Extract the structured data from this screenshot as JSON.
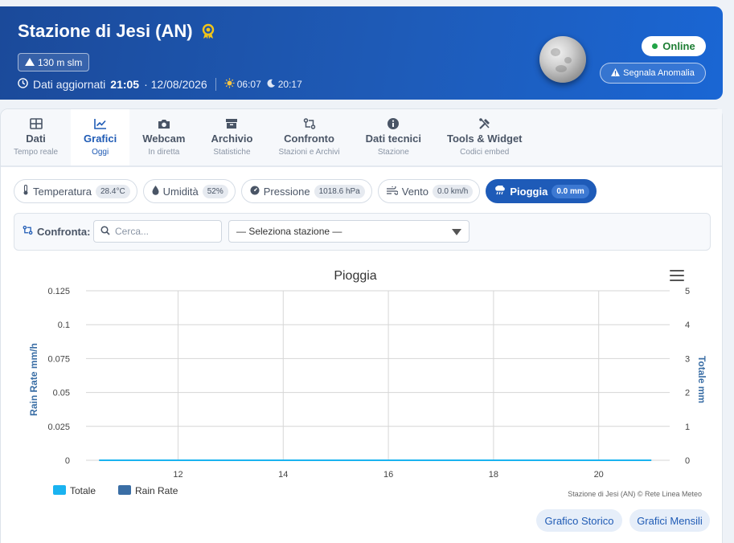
{
  "header": {
    "title": "Stazione di Jesi (AN)",
    "altitude": "130 m slm",
    "updated_label": "Dati aggiornati",
    "updated_time": "21:05",
    "updated_date": "· 12/08/2026",
    "sunrise": "06:07",
    "sunset": "20:17",
    "status": "Online",
    "report_label": "Segnala Anomalia"
  },
  "tabs": [
    {
      "label": "Dati",
      "sub": "Tempo reale",
      "icon": "table-icon"
    },
    {
      "label": "Grafici",
      "sub": "Oggi",
      "icon": "chart-icon",
      "active": true
    },
    {
      "label": "Webcam",
      "sub": "In diretta",
      "icon": "camera-icon"
    },
    {
      "label": "Archivio",
      "sub": "Statistiche",
      "icon": "archive-icon"
    },
    {
      "label": "Confronto",
      "sub": "Stazioni e Archivi",
      "icon": "compare-icon"
    },
    {
      "label": "Dati tecnici",
      "sub": "Stazione",
      "icon": "info-icon"
    },
    {
      "label": "Tools & Widget",
      "sub": "Codici embed",
      "icon": "tools-icon"
    }
  ],
  "chips": [
    {
      "label": "Temperatura",
      "value": "28.4°C",
      "icon": "thermometer-icon"
    },
    {
      "label": "Umidità",
      "value": "52%",
      "icon": "droplet-icon"
    },
    {
      "label": "Pressione",
      "value": "1018.6 hPa",
      "icon": "gauge-icon"
    },
    {
      "label": "Vento",
      "value": "0.0 km/h",
      "icon": "wind-icon"
    },
    {
      "label": "Pioggia",
      "value": "0.0 mm",
      "icon": "rain-icon",
      "active": true
    }
  ],
  "compare": {
    "label": "Confronta:",
    "search_placeholder": "Cerca...",
    "select_value": "— Seleziona stazione —"
  },
  "chart_data": {
    "type": "line",
    "title": "Pioggia",
    "x_ticks": [
      12,
      14,
      16,
      18,
      20
    ],
    "xlim": [
      10.25,
      21.35
    ],
    "y_left": {
      "label": "Rain Rate mm/h",
      "ticks": [
        "0",
        "0.025",
        "0.05",
        "0.075",
        "0.1",
        "0.125"
      ],
      "ylim": [
        0,
        0.125
      ]
    },
    "y_right": {
      "label": "Totale mm",
      "ticks": [
        "0",
        "1",
        "2",
        "3",
        "4",
        "5"
      ],
      "ylim": [
        0,
        5
      ]
    },
    "grid": true,
    "series": [
      {
        "name": "Totale",
        "color": "#1ab3f0",
        "x": [
          10.5,
          21
        ],
        "values": [
          0,
          0
        ]
      },
      {
        "name": "Rain Rate",
        "color": "#3a6ea5",
        "x": [
          10.5,
          21
        ],
        "values": [
          0,
          0
        ]
      }
    ],
    "legend": "bottom-left",
    "credit": "Stazione di Jesi (AN) © Rete Linea Meteo"
  },
  "buttons": {
    "historic": "Grafico Storico",
    "monthly": "Grafici Mensili"
  }
}
